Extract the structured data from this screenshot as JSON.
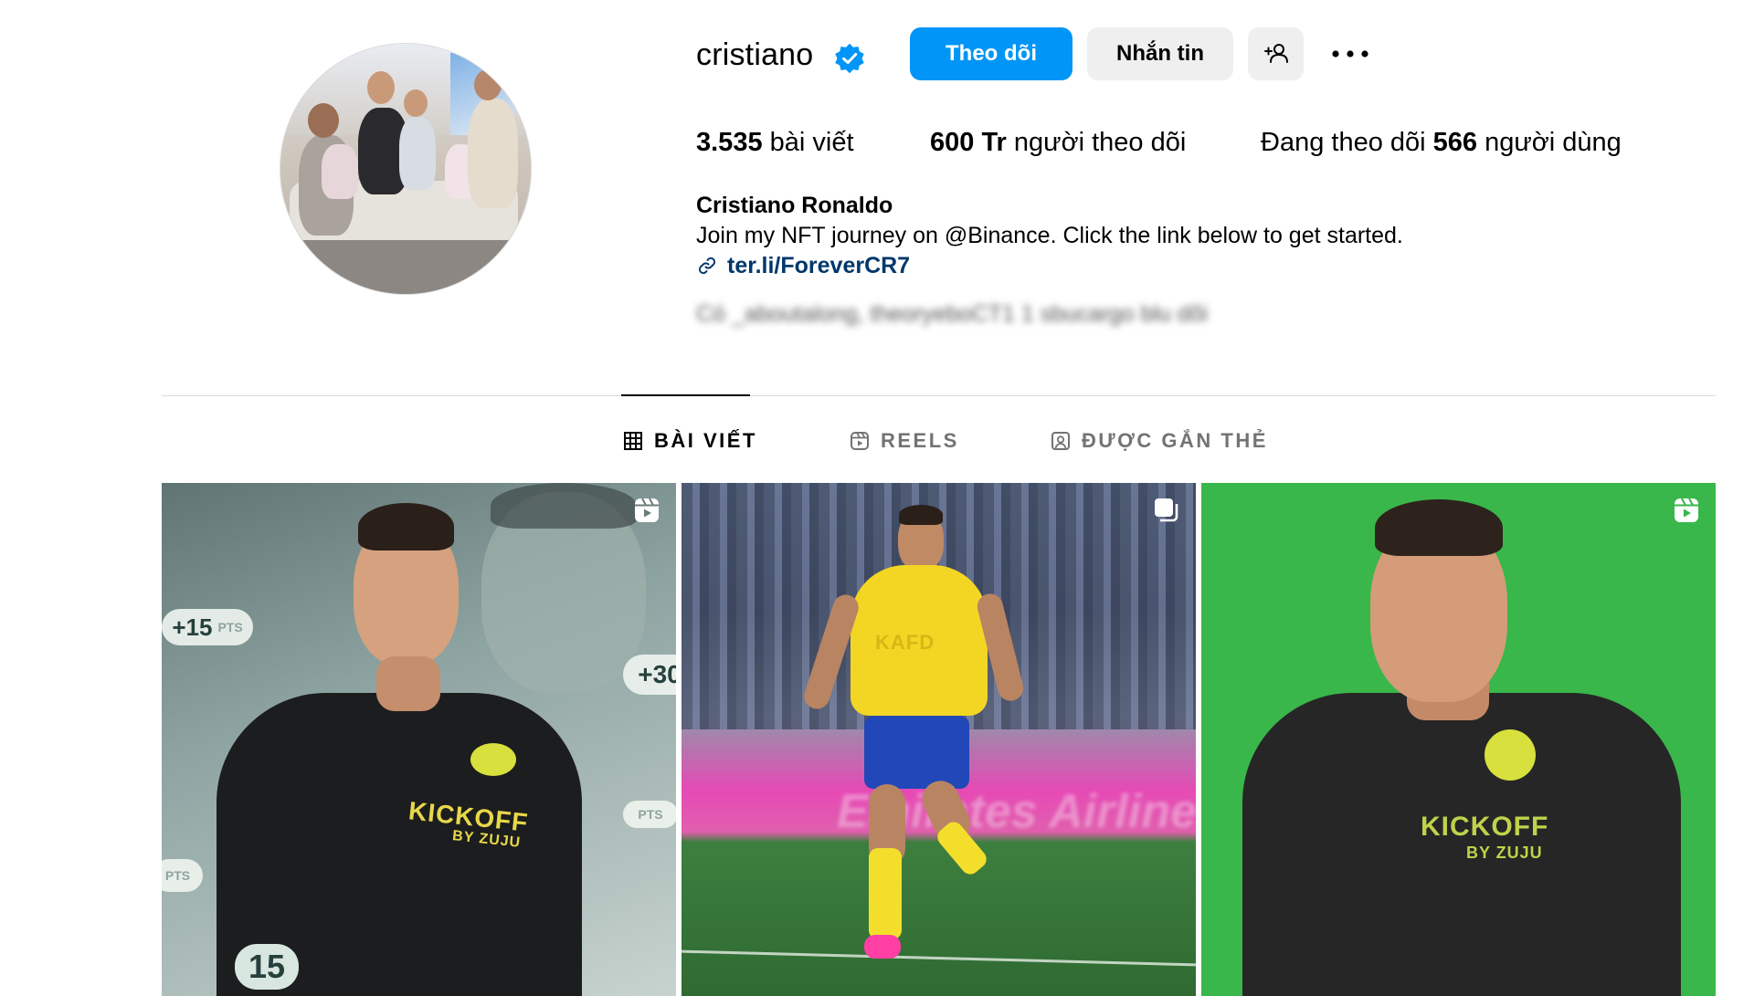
{
  "profile": {
    "username": "cristiano",
    "verified": true,
    "full_name": "Cristiano Ronaldo",
    "bio": "Join my NFT journey on @Binance. Click the link below to get started.",
    "link": "ter.li/ForeverCR7",
    "blurred_text": "Có _aboutalong, theoryeboCT1 1 sbucargo blu dõi"
  },
  "actions": {
    "follow_label": "Theo dõi",
    "message_label": "Nhắn tin",
    "add_user_icon": "person-add-icon",
    "more_icon": "more-horizontal-icon"
  },
  "stats": {
    "posts_value": "3.535",
    "posts_label": "bài viết",
    "followers_value": "600 Tr",
    "followers_label": "người theo dõi",
    "following_prefix": "Đang theo dõi",
    "following_value": "566",
    "following_label": "người dùng"
  },
  "tabs": [
    {
      "label": "BÀI VIẾT",
      "icon": "grid-icon",
      "active": true
    },
    {
      "label": "REELS",
      "icon": "reels-icon",
      "active": false
    },
    {
      "label": "ĐƯỢC GẮN THẺ",
      "icon": "tagged-icon",
      "active": false
    }
  ],
  "posts": [
    {
      "type": "reel",
      "icon": "reels-icon",
      "overlay_texts": [
        "+15",
        "PTS",
        "+30",
        "PTS",
        "PTS",
        "15"
      ],
      "brand": "KICKOFF",
      "brand_sub": "BY ZUJU"
    },
    {
      "type": "carousel",
      "icon": "carousel-icon",
      "banner": "Emirates Airline",
      "shirt_text": "KAFD"
    },
    {
      "type": "reel",
      "icon": "reels-icon",
      "brand": "KICKOFF",
      "brand_sub": "BY ZUJU"
    }
  ],
  "colors": {
    "primary_button": "#0095f6",
    "secondary_button": "#efefef",
    "link": "#00376b",
    "verified_badge": "#0095f6",
    "inactive_tab": "#737373"
  }
}
